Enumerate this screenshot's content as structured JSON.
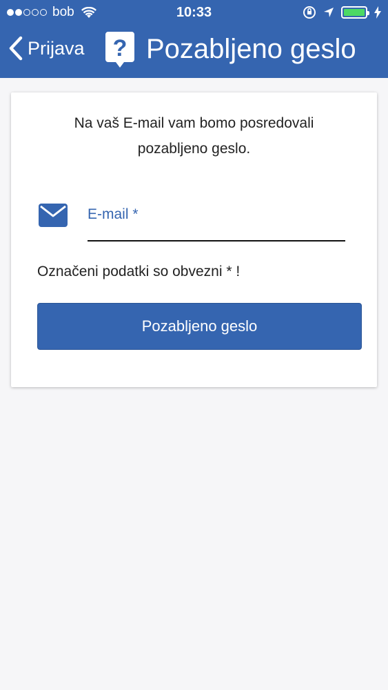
{
  "status_bar": {
    "carrier": "bob",
    "time": "10:33"
  },
  "nav": {
    "back_label": "Prijava",
    "title": "Pozabljeno geslo"
  },
  "form": {
    "intro_text": "Na vaš E-mail vam bomo posredovali pozabljeno geslo.",
    "email_label": "E-mail *",
    "email_value": "",
    "required_note": "Označeni podatki so obvezni * !",
    "submit_label": "Pozabljeno geslo"
  },
  "colors": {
    "primary": "#3565b0",
    "background": "#f6f6f8",
    "battery": "#4cd964"
  },
  "icons": [
    "back-chevron-icon",
    "question-icon",
    "mail-icon",
    "wifi-icon",
    "orientation-lock-icon",
    "location-arrow-icon",
    "battery-icon",
    "charging-icon"
  ]
}
